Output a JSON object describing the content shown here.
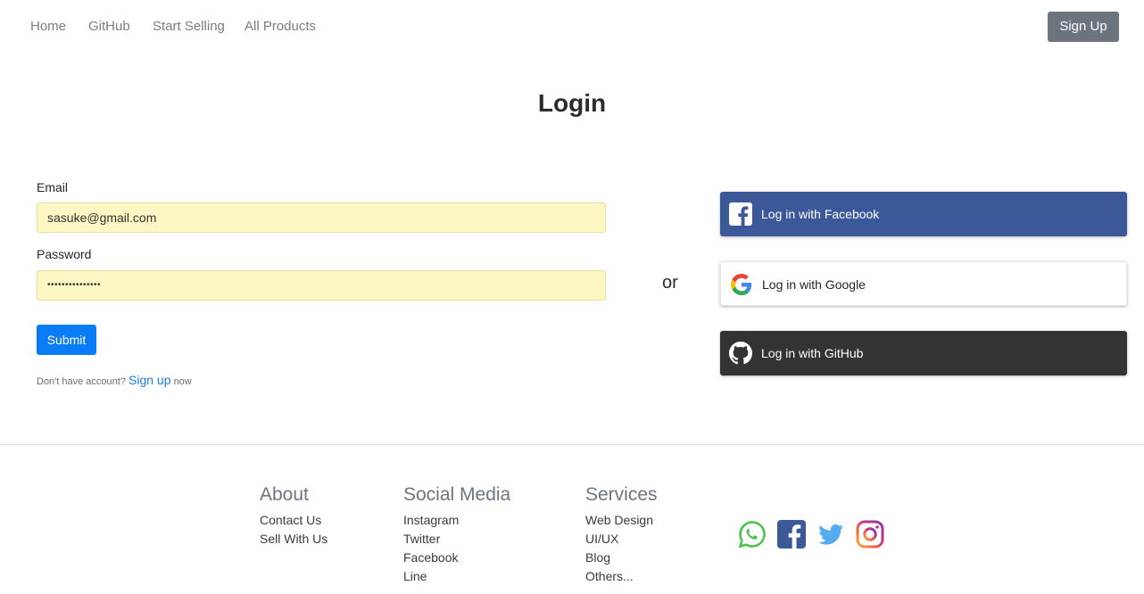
{
  "nav": {
    "links": [
      "Home",
      "GitHub",
      "Start Selling",
      "All Products"
    ],
    "signup": "Sign Up"
  },
  "login": {
    "title": "Login",
    "email_label": "Email",
    "email_value": "sasuke@gmail.com",
    "password_label": "Password",
    "password_value": "•••••••••••••••",
    "submit": "Submit",
    "hint_prefix": "Don't have account?",
    "hint_link": "Sign up",
    "hint_suffix": "now"
  },
  "or": "or",
  "social_login": {
    "facebook": "Log in with Facebook",
    "google": "Log in with Google",
    "github": "Log in with GitHub"
  },
  "footer": {
    "about": {
      "title": "About",
      "items": [
        "Contact Us",
        "Sell With Us"
      ]
    },
    "social": {
      "title": "Social Media",
      "items": [
        "Instagram",
        "Twitter",
        "Facebook",
        "Line"
      ]
    },
    "services": {
      "title": "Services",
      "items": [
        "Web Design",
        "UI/UX",
        "Blog",
        "Others..."
      ]
    },
    "icons": [
      "whatsapp-icon",
      "facebook-icon",
      "twitter-icon",
      "instagram-icon"
    ]
  },
  "colors": {
    "facebook": "#3b5998",
    "github": "#333333",
    "primary": "#0a7cf5",
    "signup": "#6c757d",
    "autofill": "#fdf7c3"
  }
}
